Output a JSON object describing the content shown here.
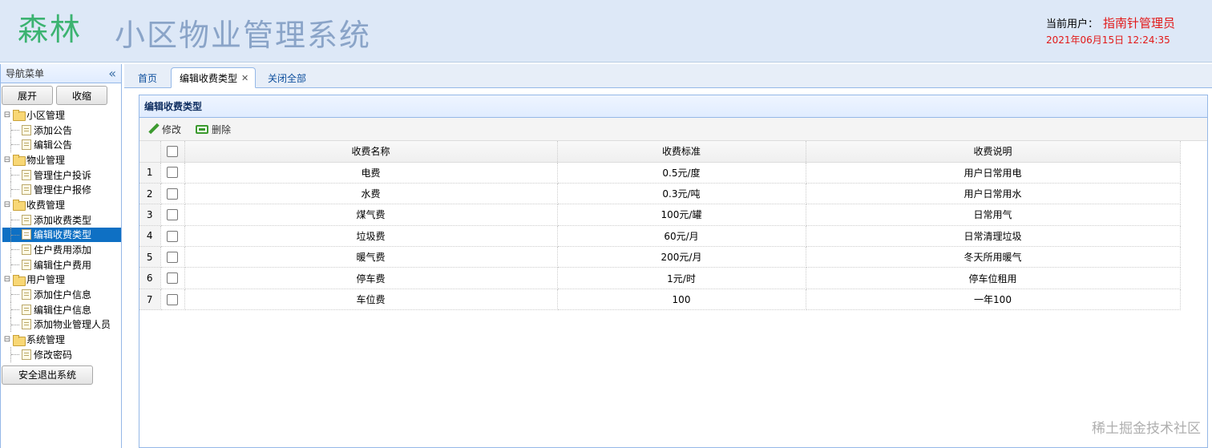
{
  "header": {
    "logo": "森林",
    "title": "小区物业管理系统",
    "user_label": "当前用户：",
    "user_name": "指南针管理员",
    "datetime": "2021年06月15日 12:24:35"
  },
  "sidebar": {
    "heading": "导航菜单",
    "expand_label": "展开",
    "collapse_label": "收缩",
    "logout_label": "安全退出系统",
    "groups": [
      {
        "label": "小区管理",
        "items": [
          "添加公告",
          "编辑公告"
        ]
      },
      {
        "label": "物业管理",
        "items": [
          "管理住户投诉",
          "管理住户报修"
        ]
      },
      {
        "label": "收费管理",
        "items": [
          "添加收费类型",
          "编辑收费类型",
          "住户费用添加",
          "编辑住户费用"
        ]
      },
      {
        "label": "用户管理",
        "items": [
          "添加住户信息",
          "编辑住户信息",
          "添加物业管理人员"
        ]
      },
      {
        "label": "系统管理",
        "items": [
          "修改密码"
        ]
      }
    ],
    "selected": "编辑收费类型"
  },
  "tabs": {
    "home": "首页",
    "active": "编辑收费类型",
    "close_all": "关闭全部"
  },
  "panel": {
    "title": "编辑收费类型",
    "edit_label": "修改",
    "delete_label": "删除"
  },
  "table": {
    "columns": [
      "收费名称",
      "收费标准",
      "收费说明"
    ],
    "rows": [
      {
        "n": "1",
        "name": "电费",
        "standard": "0.5元/度",
        "desc": "用户日常用电"
      },
      {
        "n": "2",
        "name": "水费",
        "standard": "0.3元/吨",
        "desc": "用户日常用水"
      },
      {
        "n": "3",
        "name": "煤气费",
        "standard": "100元/罐",
        "desc": "日常用气"
      },
      {
        "n": "4",
        "name": "垃圾费",
        "standard": "60元/月",
        "desc": "日常清理垃圾"
      },
      {
        "n": "5",
        "name": "暖气费",
        "standard": "200元/月",
        "desc": "冬天所用暖气"
      },
      {
        "n": "6",
        "name": "停车费",
        "standard": "1元/时",
        "desc": "停车位租用"
      },
      {
        "n": "7",
        "name": "车位费",
        "standard": "100",
        "desc": "一年100"
      }
    ]
  },
  "watermark": "稀土掘金技术社区",
  "colors": {
    "accent": "#0e70c4",
    "logo": "#3cb371",
    "user": "#e21818"
  }
}
